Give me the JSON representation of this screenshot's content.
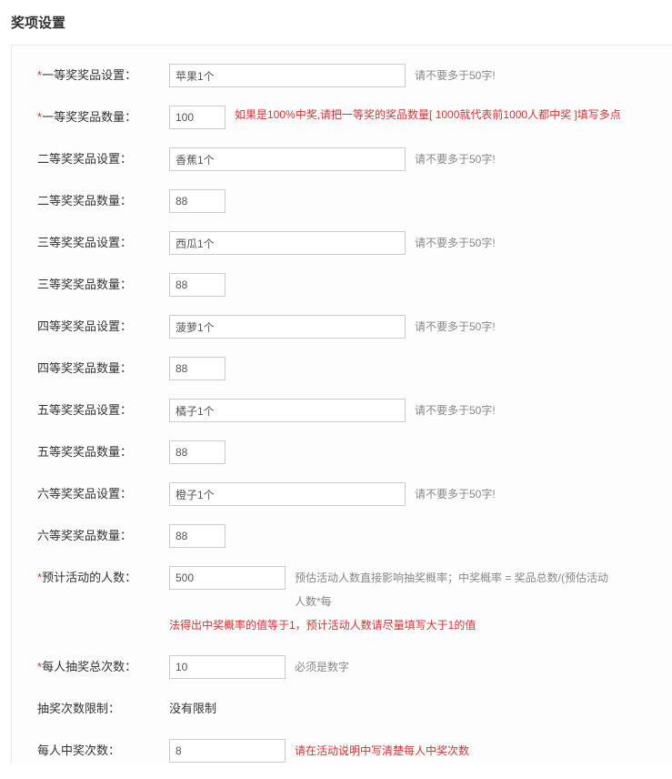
{
  "title": "奖项设置",
  "rows": {
    "p1name": {
      "star": true,
      "label": "一等奖奖品设置：",
      "value": "苹果1个",
      "hint": "请不要多于50字!"
    },
    "p1qty": {
      "star": true,
      "label": "一等奖奖品数量：",
      "value": "100",
      "hint_red": "如果是100%中奖,请把一等奖的奖品数量[ 1000就代表前1000人都中奖 ]填写多点"
    },
    "p2name": {
      "star": false,
      "label": "二等奖奖品设置：",
      "value": "香蕉1个",
      "hint": "请不要多于50字!"
    },
    "p2qty": {
      "star": false,
      "label": "二等奖奖品数量：",
      "value": "88"
    },
    "p3name": {
      "star": false,
      "label": "三等奖奖品设置：",
      "value": "西瓜1个",
      "hint": "请不要多于50字!"
    },
    "p3qty": {
      "star": false,
      "label": "三等奖奖品数量：",
      "value": "88"
    },
    "p4name": {
      "star": false,
      "label": "四等奖奖品设置：",
      "value": "菠萝1个",
      "hint": "请不要多于50字!"
    },
    "p4qty": {
      "star": false,
      "label": "四等奖奖品数量：",
      "value": "88"
    },
    "p5name": {
      "star": false,
      "label": "五等奖奖品设置：",
      "value": "橘子1个",
      "hint": "请不要多于50字!"
    },
    "p5qty": {
      "star": false,
      "label": "五等奖奖品数量：",
      "value": "88"
    },
    "p6name": {
      "star": false,
      "label": "六等奖奖品设置：",
      "value": "橙子1个",
      "hint": "请不要多于50字!"
    },
    "p6qty": {
      "star": false,
      "label": "六等奖奖品数量：",
      "value": "88"
    },
    "estppl": {
      "star": true,
      "label": "预计活动的人数：",
      "value": "500",
      "hint": "预估活动人数直接影响抽奖概率；中奖概率 = 奖品总数/(预估活动人数*每",
      "hint_red2": "法得出中奖概率的值等于1，预计活动人数请尽量填写大于1的值"
    },
    "drawtotal": {
      "star": true,
      "label": "每人抽奖总次数：",
      "value": "10",
      "hint": "必须是数字"
    },
    "drawlimit": {
      "star": false,
      "label": "抽奖次数限制：",
      "static": "没有限制"
    },
    "wincount": {
      "star": false,
      "label": "每人中奖次数：",
      "value": "8",
      "hint_red": "请在活动说明中写清楚每人中奖次数"
    }
  }
}
